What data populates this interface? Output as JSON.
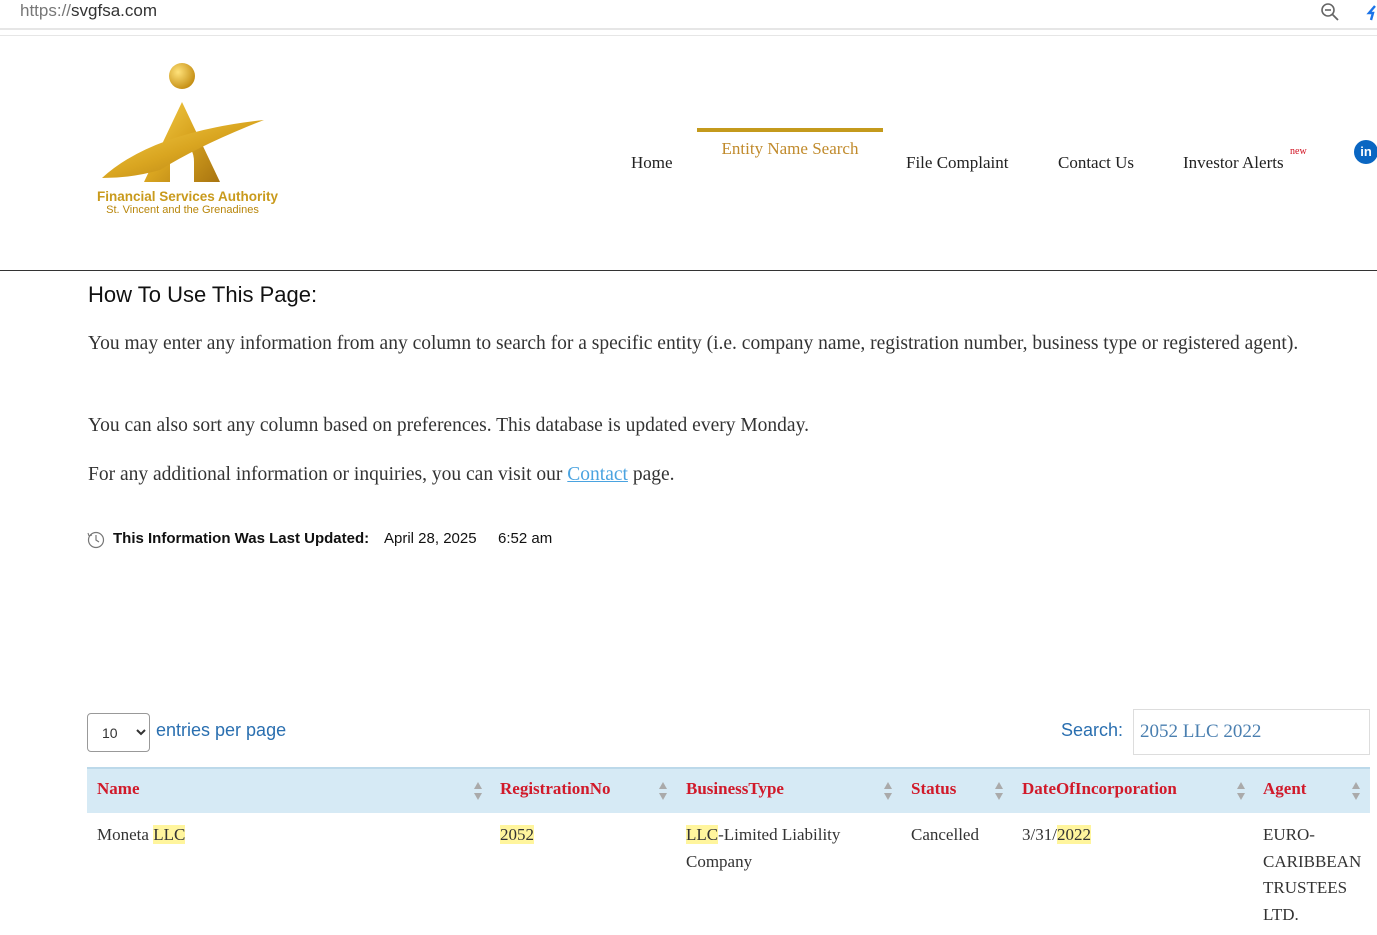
{
  "browser": {
    "url_proto": "https://",
    "url_host": "svgfsa.com"
  },
  "logo": {
    "line1": "Financial Services Authority",
    "line2": "St. Vincent and the Grenadines"
  },
  "nav": {
    "items": [
      "Home",
      "Entity Name Search",
      "File Complaint",
      "Contact Us",
      "Investor Alerts"
    ],
    "new_badge": "new",
    "linkedin": "in"
  },
  "content": {
    "title": "How To Use This Page:",
    "p1": "You may enter any information from any column to search for a specific entity (i.e. company name, registration number, business type or registered agent).",
    "p2": "You can also sort any column based on preferences. This database is updated every Monday.",
    "p3_before": "For any additional information or inquiries, you can visit our ",
    "p3_link": "Contact",
    "p3_after": " page."
  },
  "updated": {
    "label": "This Information Was Last Updated:",
    "date": "April 28, 2025",
    "time": "6:52 am"
  },
  "table_controls": {
    "entries_value": "10",
    "entries_label": "entries per page",
    "search_label": "Search:",
    "search_value": "2052 LLC 2022"
  },
  "table": {
    "headers": [
      "Name",
      "RegistrationNo",
      "BusinessType",
      "Status",
      "DateOfIncorporation",
      "Agent"
    ],
    "row": {
      "name_pre": "Moneta ",
      "name_hl": "LLC",
      "reg_hl": "2052",
      "type_hl": "LLC",
      "type_rest": "-Limited Liability Company",
      "status": "Cancelled",
      "date_pre": "3/31/",
      "date_hl": "2022",
      "agent": "EURO-CARIBBEAN TRUSTEES LTD."
    }
  }
}
